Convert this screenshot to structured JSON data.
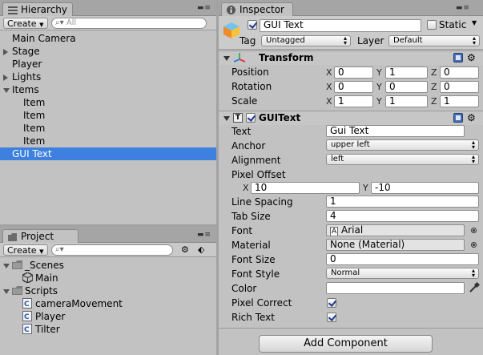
{
  "hierarchy": {
    "tab_label": "Hierarchy",
    "create_label": "Create",
    "search_placeholder": "All",
    "items": [
      {
        "label": "Main Camera",
        "indent": 0,
        "arrow": "none"
      },
      {
        "label": "Stage",
        "indent": 0,
        "arrow": "right"
      },
      {
        "label": "Player",
        "indent": 0,
        "arrow": "none"
      },
      {
        "label": "Lights",
        "indent": 0,
        "arrow": "right"
      },
      {
        "label": "Items",
        "indent": 0,
        "arrow": "down"
      },
      {
        "label": "Item",
        "indent": 1,
        "arrow": "none"
      },
      {
        "label": "Item",
        "indent": 1,
        "arrow": "none"
      },
      {
        "label": "Item",
        "indent": 1,
        "arrow": "none"
      },
      {
        "label": "Item",
        "indent": 1,
        "arrow": "none"
      },
      {
        "label": "GUI Text",
        "indent": 0,
        "arrow": "none",
        "selected": true
      }
    ]
  },
  "project": {
    "tab_label": "Project",
    "create_label": "Create",
    "items": [
      {
        "label": "_Scenes",
        "indent": 0,
        "icon": "folder-icon",
        "arrow": "down"
      },
      {
        "label": "Main",
        "indent": 1,
        "icon": "unity-scene-icon",
        "arrow": "none"
      },
      {
        "label": "Scripts",
        "indent": 0,
        "icon": "folder-icon",
        "arrow": "down"
      },
      {
        "label": "cameraMovement",
        "indent": 1,
        "icon": "script-icon",
        "arrow": "none"
      },
      {
        "label": "Player",
        "indent": 1,
        "icon": "script-icon",
        "arrow": "none"
      },
      {
        "label": "Tilter",
        "indent": 1,
        "icon": "script-icon",
        "arrow": "none"
      }
    ]
  },
  "inspector": {
    "tab_label": "Inspector",
    "object_name": "GUI Text",
    "static_label": "Static",
    "tag_label": "Tag",
    "tag_value": "Untagged",
    "layer_label": "Layer",
    "layer_value": "Default",
    "transform": {
      "title": "Transform",
      "rows": [
        {
          "label": "Position",
          "x": "0",
          "y": "1",
          "z": "0"
        },
        {
          "label": "Rotation",
          "x": "0",
          "y": "0",
          "z": "0"
        },
        {
          "label": "Scale",
          "x": "1",
          "y": "1",
          "z": "1"
        }
      ],
      "axis_x": "X",
      "axis_y": "Y",
      "axis_z": "Z"
    },
    "guitext": {
      "title": "GUIText",
      "text_label": "Text",
      "text_value": "Gui Text",
      "anchor_label": "Anchor",
      "anchor_value": "upper left",
      "alignment_label": "Alignment",
      "alignment_value": "left",
      "pixel_offset_label": "Pixel Offset",
      "offset_x_label": "X",
      "offset_x": "10",
      "offset_y_label": "Y",
      "offset_y": "-10",
      "line_spacing_label": "Line Spacing",
      "line_spacing": "1",
      "tab_size_label": "Tab Size",
      "tab_size": "4",
      "font_label": "Font",
      "font_value": "Arial",
      "material_label": "Material",
      "material_value": "None (Material)",
      "font_size_label": "Font Size",
      "font_size": "0",
      "font_style_label": "Font Style",
      "font_style": "Normal",
      "color_label": "Color",
      "color_value": "#ffffff",
      "pixel_correct_label": "Pixel Correct",
      "pixel_correct": true,
      "rich_text_label": "Rich Text",
      "rich_text": true
    },
    "add_component_label": "Add Component"
  }
}
